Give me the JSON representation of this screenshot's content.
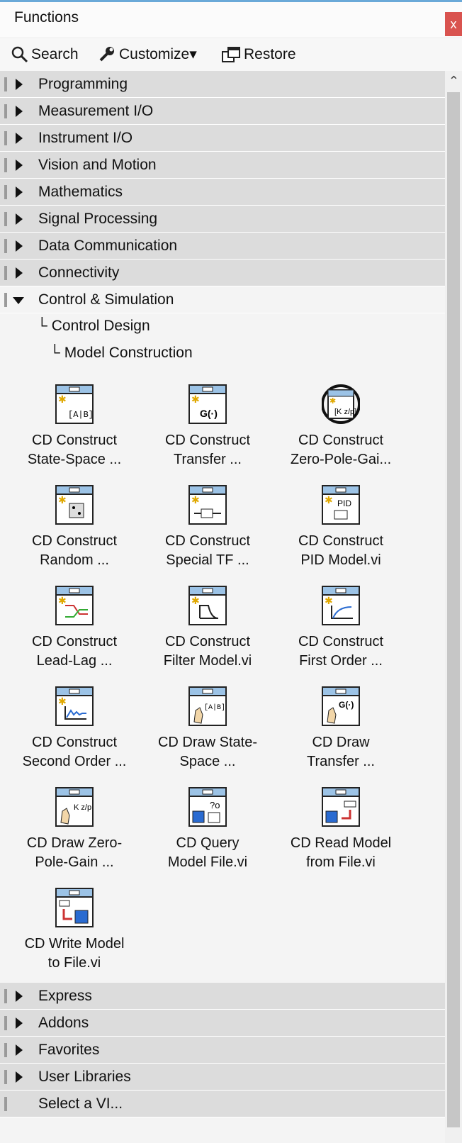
{
  "window": {
    "title": "Functions",
    "close_label": "x"
  },
  "toolbar": {
    "search": "Search",
    "customize": "Customize▾",
    "restore": "Restore"
  },
  "categories_top": [
    {
      "label": "Programming"
    },
    {
      "label": "Measurement I/O"
    },
    {
      "label": "Instrument I/O"
    },
    {
      "label": "Vision and Motion"
    },
    {
      "label": "Mathematics"
    },
    {
      "label": "Signal Processing"
    },
    {
      "label": "Data Communication"
    },
    {
      "label": "Connectivity"
    }
  ],
  "open_category": {
    "label": "Control & Simulation"
  },
  "breadcrumb": {
    "level1": "Control Design",
    "level2": "Model Construction"
  },
  "items": [
    {
      "caption": "CD Construct\nState-Space ...",
      "icon": "state-space-icon"
    },
    {
      "caption": "CD Construct\nTransfer ...",
      "icon": "transfer-function-icon"
    },
    {
      "caption": "CD Construct\nZero-Pole-Gai...",
      "icon": "zero-pole-gain-icon"
    },
    {
      "caption": "CD Construct\nRandom ...",
      "icon": "random-model-icon"
    },
    {
      "caption": "CD Construct\nSpecial TF ...",
      "icon": "special-tf-icon"
    },
    {
      "caption": "CD Construct\nPID Model.vi",
      "icon": "pid-model-icon"
    },
    {
      "caption": "CD Construct\nLead-Lag ...",
      "icon": "lead-lag-icon"
    },
    {
      "caption": "CD Construct\nFilter Model.vi",
      "icon": "filter-model-icon"
    },
    {
      "caption": "CD Construct\nFirst Order ...",
      "icon": "first-order-icon"
    },
    {
      "caption": "CD Construct\nSecond Order ...",
      "icon": "second-order-icon"
    },
    {
      "caption": "CD Draw State-\nSpace ...",
      "icon": "draw-state-space-icon"
    },
    {
      "caption": "CD Draw\nTransfer ...",
      "icon": "draw-transfer-icon"
    },
    {
      "caption": "CD Draw Zero-\nPole-Gain ...",
      "icon": "draw-zpk-icon"
    },
    {
      "caption": "CD Query\nModel File.vi",
      "icon": "query-model-file-icon"
    },
    {
      "caption": "CD Read Model\nfrom File.vi",
      "icon": "read-model-file-icon"
    },
    {
      "caption": "CD Write Model\nto File.vi",
      "icon": "write-model-file-icon"
    }
  ],
  "categories_bottom": [
    {
      "label": "Express"
    },
    {
      "label": "Addons"
    },
    {
      "label": "Favorites"
    },
    {
      "label": "User Libraries"
    },
    {
      "label": "Select a VI..."
    }
  ]
}
